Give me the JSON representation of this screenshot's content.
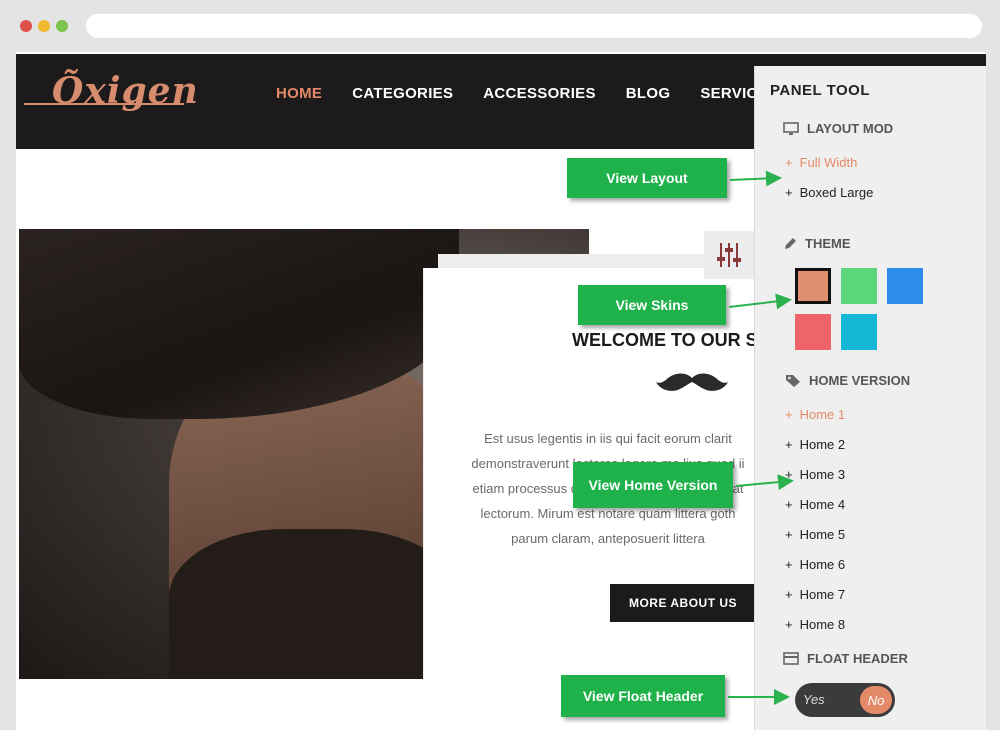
{
  "header": {
    "logo_text": "Õxigen",
    "nav": [
      "HOME",
      "CATEGORIES",
      "ACCESSORIES",
      "BLOG",
      "SERVICES"
    ]
  },
  "main": {
    "welcome_title": "WELCOME TO OUR S",
    "welcome_lines": [
      "Est usus legentis in iis qui facit eorum clarit",
      "demonstraverunt lectores legere me lius quod ii",
      "etiam processus dynamicus, qui sequitur mutat",
      "lectorum. Mirum est notare quam littera goth",
      "parum claram, anteposuerit littera"
    ],
    "more_button": "MORE ABOUT US"
  },
  "panel": {
    "title": "PANEL TOOL",
    "layout": {
      "heading": "LAYOUT MOD",
      "icon": "monitor-icon",
      "options": [
        "Full Width",
        "Boxed Large"
      ],
      "selected": "Full Width"
    },
    "theme": {
      "heading": "THEME",
      "icon": "pencil-icon",
      "swatches": [
        "#e08f6e",
        "#5bd67a",
        "#2c8ceb",
        "#ef6468",
        "#12b8d4"
      ],
      "selected": "#e08f6e"
    },
    "home_version": {
      "heading": "HOME VERSION",
      "icon": "tag-icon",
      "options": [
        "Home 1",
        "Home 2",
        "Home 3",
        "Home 4",
        "Home 5",
        "Home 6",
        "Home 7",
        "Home 8"
      ],
      "selected": "Home 1"
    },
    "float_header": {
      "heading": "FLOAT HEADER",
      "icon": "card-icon",
      "yes_label": "Yes",
      "no_label": "No",
      "value": "No"
    }
  },
  "callouts": [
    "View Layout",
    "View Skins",
    "View Home Version",
    "View Float Header"
  ],
  "colors": {
    "accent": "#e48a68",
    "header_bg": "#1c1a1a",
    "callout_green": "#1fb14a",
    "arrow_green": "#2bb24f"
  }
}
